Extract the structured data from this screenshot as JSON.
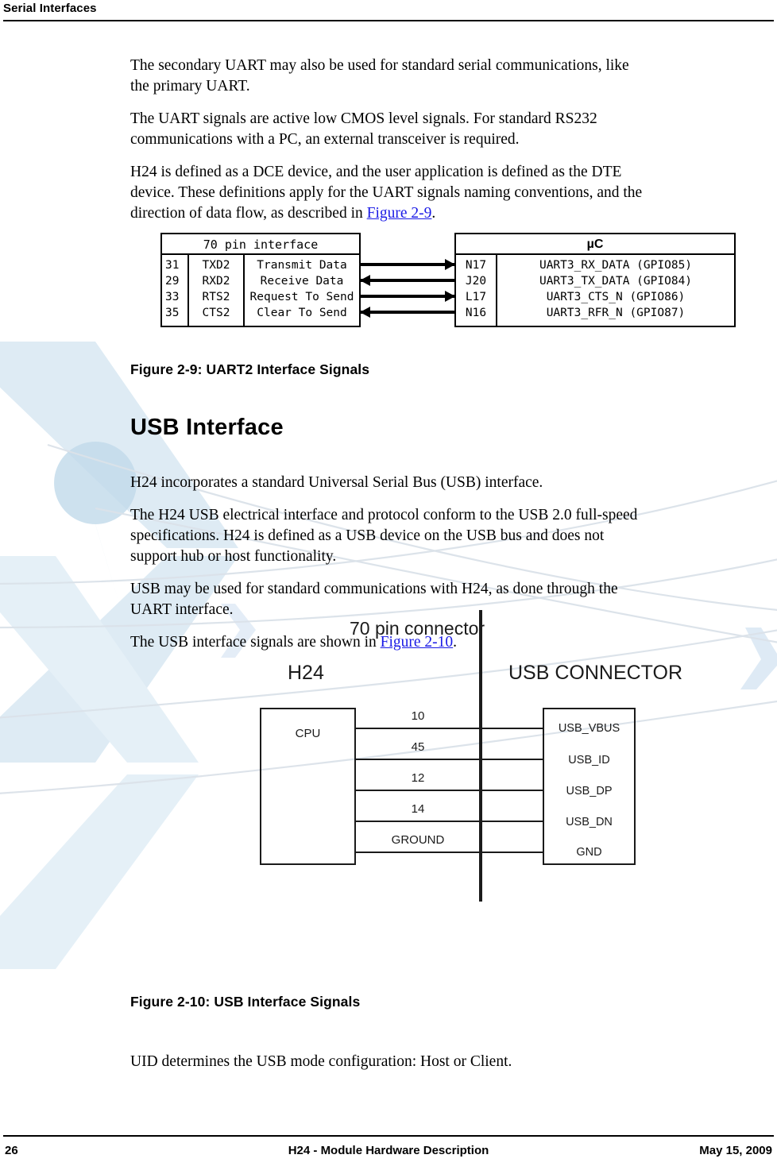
{
  "header": {
    "title": "Serial Interfaces"
  },
  "footer": {
    "page_number": "26",
    "doc_title": "H24 - Module Hardware Description",
    "date": "May 15, 2009"
  },
  "body": {
    "p1": "The secondary UART may also be used for standard serial communications, like the primary UART.",
    "p2": "The UART signals are active low CMOS level signals. For standard RS232 communications with a PC, an external transceiver is required.",
    "p3_before": "H24 is defined as a DCE device, and the user application is defined as the DTE device. These definitions apply for the UART signals naming conventions, and the direction of data flow, as described in ",
    "p3_xref": "Figure 2-9",
    "p3_after": ".",
    "section_usb": "USB Interface",
    "p4": "H24 incorporates a standard Universal Serial Bus (USB) interface.",
    "p5": "The H24 USB electrical interface and protocol conform to the USB 2.0 full-speed specifications. H24 is defined as a USB device on the USB bus and does not support hub or host functionality.",
    "p6": "USB may be used for standard communications with H24, as done through the UART interface.",
    "p7_before": "The USB interface signals are shown in ",
    "p7_xref": "Figure 2-10",
    "p7_after": ".",
    "p8": "UID determines the USB mode configuration: Host or Client."
  },
  "figure_uart": {
    "caption": "Figure 2-9: UART2 Interface Signals",
    "left_title": "70 pin interface",
    "right_title": "µC",
    "rows": [
      {
        "pin": "31",
        "name": "TXD2",
        "desc": "Transmit Data",
        "direction": "right",
        "uc_pin": "N17",
        "uc_signal": "UART3_RX_DATA (GPIO85)"
      },
      {
        "pin": "29",
        "name": "RXD2",
        "desc": "Receive Data",
        "direction": "left",
        "uc_pin": "J20",
        "uc_signal": "UART3_TX_DATA (GPIO84)"
      },
      {
        "pin": "33",
        "name": "RTS2",
        "desc": "Request To Send",
        "direction": "right",
        "uc_pin": "L17",
        "uc_signal": "UART3_CTS_N (GPIO86)"
      },
      {
        "pin": "35",
        "name": "CTS2",
        "desc": "Clear To Send",
        "direction": "left",
        "uc_pin": "N16",
        "uc_signal": "UART3_RFR_N (GPIO87)"
      }
    ]
  },
  "figure_usb": {
    "caption": "Figure 2-10: USB Interface Signals",
    "heading_connector_70pin": "70 pin connector",
    "heading_left": "H24",
    "heading_right": "USB CONNECTOR",
    "cpu_label": "CPU",
    "signals": [
      {
        "pin": "10",
        "name": "USB_VBUS"
      },
      {
        "pin": "45",
        "name": "USB_ID"
      },
      {
        "pin": "12",
        "name": "USB_DP"
      },
      {
        "pin": "14",
        "name": "USB_DN"
      },
      {
        "pin": "GROUND",
        "name": "GND"
      }
    ]
  },
  "colors": {
    "link": "#1a1ae6",
    "ink": "#000000",
    "diagram_ink": "#1b1b1b",
    "watermark_blue": "#bcd6ea",
    "watermark_line": "#d9dfe6"
  }
}
